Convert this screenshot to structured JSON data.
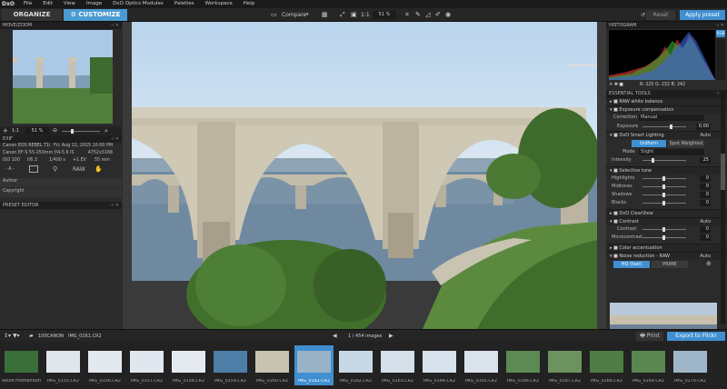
{
  "app": {
    "logo": "DxO"
  },
  "menu": [
    "File",
    "Edit",
    "View",
    "Image",
    "DxO Optics Modules",
    "Palettes",
    "Workspace",
    "Help"
  ],
  "tabs": {
    "organize": "ORGANIZE",
    "customize": "CUSTOMIZE"
  },
  "toolbar": {
    "compare": "Compare",
    "zoom_ratio": "1:1",
    "zoom_percent": "51 %",
    "reset": "Reset",
    "apply": "Apply preset"
  },
  "left": {
    "move_zoom": "MOVE/ZOOM",
    "zoom_ratio": "1:1",
    "zoom_percent": "51 %",
    "exif_title": "EXIF",
    "camera": "Canon EOS REBEL T1i",
    "date": "Fri, Aug 21, 2015 10:00 PM",
    "lens": "Canon EF-S 55-250mm f/4-5.6 IS",
    "dimensions": "4752x3168",
    "iso": "ISO 100",
    "aperture": "f/6.3",
    "shutter": "1/400 s",
    "ev": "+1 EV",
    "focal": "55 mm",
    "format": "RAW",
    "author_label": "Author",
    "copyright_label": "Copyright",
    "preset_editor": "PRESET EDITOR"
  },
  "right": {
    "histogram_title": "HISTOGRAM",
    "rgb": "RGB",
    "readout": "R: 225  G: 232  B: 242",
    "essential": "ESSENTIAL TOOLS",
    "raw_wb": "RAW white balance",
    "exposure_comp": "Exposure compensation",
    "correction_label": "Correction",
    "correction_value": "Manual",
    "exposure_label": "Exposure",
    "exposure_value": "0.00",
    "smart_lighting": "DxO Smart Lighting",
    "auto": "Auto",
    "uniform": "Uniform",
    "spot_weighted": "Spot Weighted",
    "mode_label": "Mode",
    "mode_value": "Slight",
    "intensity_label": "Intensity",
    "intensity_value": "25",
    "selective_tone": "Selective tone",
    "highlights": "Highlights",
    "midtones": "Midtones",
    "shadows": "Shadows",
    "blacks": "Blacks",
    "zero": "0",
    "clearview": "DxO ClearView",
    "contrast_head": "Contrast",
    "contrast": "Contrast",
    "microcontrast": "Microcontrast",
    "color_accent": "Color accentuation",
    "noise": "Noise reduction - RAW",
    "hq_fast": "HQ (fast)",
    "prime": "PRIME"
  },
  "filmbar": {
    "folder": "100CANON",
    "file": "IMG_0161.CR2",
    "counter": "1 / 454  images",
    "print": "Print",
    "export": "Export to Flickr"
  },
  "thumbs": [
    "Azure momentum...",
    "IMG_0155.CR2",
    "IMG_0156.CR2",
    "IMG_0157.CR2",
    "IMG_0158.CR2",
    "IMG_0159.CR2",
    "IMG_0160.CR2",
    "IMG_0161.CR2",
    "IMG_0162.CR2",
    "IMG_0163.CR2",
    "IMG_0164.CR2",
    "IMG_0165.CR2",
    "IMG_0166.CR2",
    "IMG_0167.CR2",
    "IMG_0168.CR2",
    "IMG_0169.CR2",
    "IMG_0170.CR2"
  ],
  "colors": {
    "accent": "#4a9bd1",
    "bg": "#2b2b2b"
  }
}
